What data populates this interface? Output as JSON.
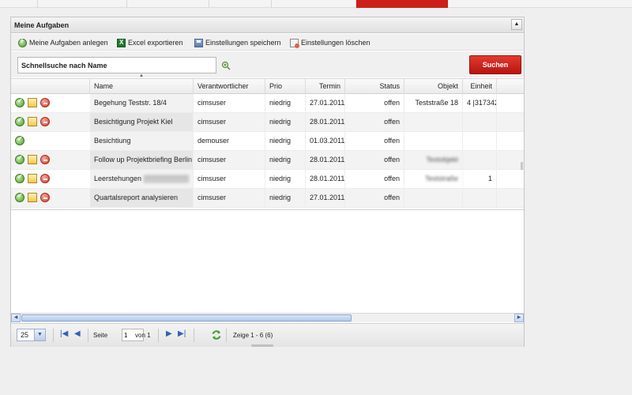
{
  "panel": {
    "title": "Meine Aufgaben",
    "collapse_symbol": "▲"
  },
  "toolbar": {
    "add_label": "Meine Aufgaben anlegen",
    "export_label": "Excel exportieren",
    "save_label": "Einstellungen speichern",
    "delete_label": "Einstellungen löschen"
  },
  "search": {
    "placeholder": "Schnellsuche nach Name",
    "button_label": "Suchen"
  },
  "colors": {
    "accent_red": "#cc1f1a",
    "scroll_blue": "#b4c9ea"
  },
  "grid": {
    "headers": {
      "name": "Name",
      "owner": "Verantwortlicher",
      "prio": "Prio",
      "termin": "Termin",
      "status": "Status",
      "objekt": "Objekt",
      "einheit": "Einheit"
    },
    "rows": [
      {
        "name": "Begehung Teststr. 18/4",
        "owner": "cimsuser",
        "prio": "niedrig",
        "termin": "27.01.2011",
        "status": "offen",
        "objekt": "Teststraße 18",
        "einheit": "4 |317342",
        "actions": [
          "ok",
          "note",
          "no"
        ]
      },
      {
        "name": "Besichtigung Projekt Kiel",
        "owner": "cimsuser",
        "prio": "niedrig",
        "termin": "28.01.2011",
        "status": "offen",
        "objekt": "",
        "einheit": "",
        "actions": [
          "ok",
          "note",
          "no"
        ]
      },
      {
        "name": "Besichtiung",
        "owner": "demouser",
        "prio": "niedrig",
        "termin": "01.03.2011",
        "status": "offen",
        "objekt": "",
        "einheit": "",
        "actions": [
          "ok"
        ]
      },
      {
        "name": "Follow up Projektbriefing Berlin",
        "owner": "cimsuser",
        "prio": "niedrig",
        "termin": "28.01.2011",
        "status": "offen",
        "objekt": "Testobjekt",
        "einheit": "",
        "actions": [
          "ok",
          "note",
          "no"
        ]
      },
      {
        "name": "Leerstehungen",
        "owner": "cimsuser",
        "prio": "niedrig",
        "termin": "28.01.2011",
        "status": "offen",
        "objekt": "Teststraße",
        "einheit": "1",
        "actions": [
          "ok",
          "note",
          "no"
        ]
      },
      {
        "name": "Quartalsreport analysieren",
        "owner": "cimsuser",
        "prio": "niedrig",
        "termin": "27.01.2011",
        "status": "offen",
        "objekt": "",
        "einheit": "",
        "actions": [
          "ok",
          "note",
          "no"
        ]
      }
    ]
  },
  "pager": {
    "page_size": "25",
    "page_label": "Seite",
    "page_value": "1",
    "of_label": "von 1",
    "display_info": "Zeige 1 - 6 (6)"
  }
}
